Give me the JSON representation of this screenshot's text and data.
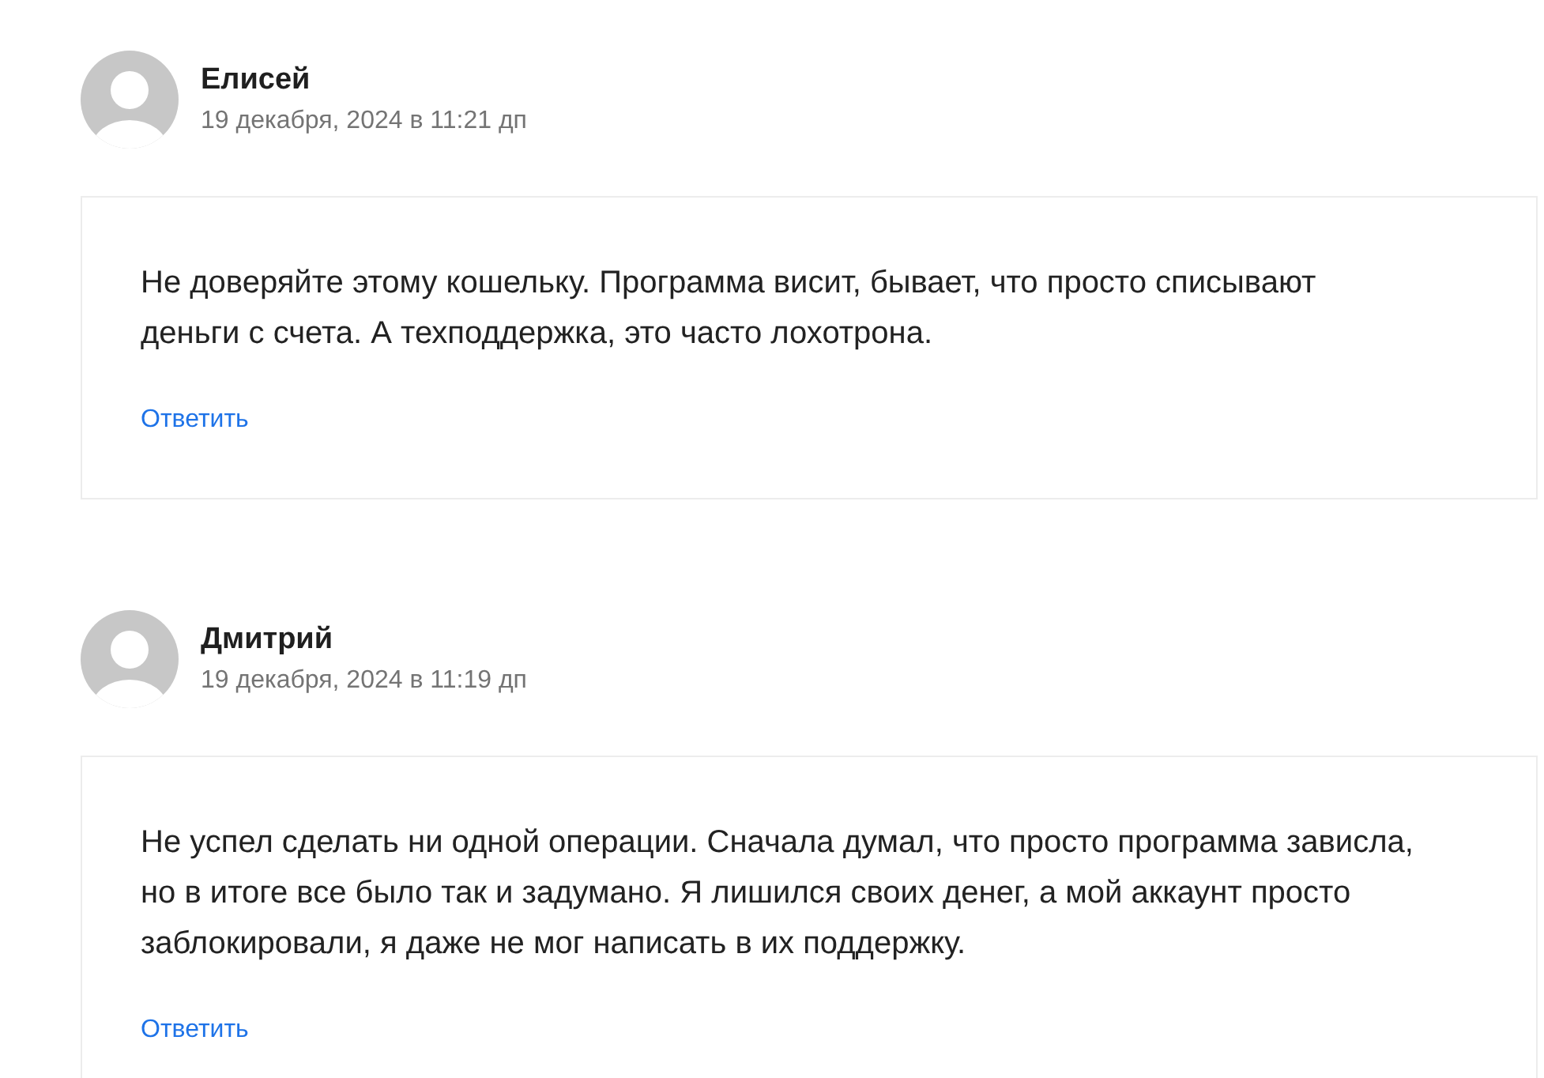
{
  "comments": [
    {
      "author": "Елисей",
      "date": "19 декабря, 2024 в 11:21 дп",
      "text": "Не доверяйте этому кошельку. Программа висит, бывает, что просто списывают деньги с счета. А техподдержка, это часто лохотрона.",
      "reply": "Ответить"
    },
    {
      "author": "Дмитрий",
      "date": "19 декабря, 2024 в 11:19 дп",
      "text": "Не успел сделать ни одной операции. Сначала думал, что просто программа зависла, но в итоге все было так и задумано. Я лишился своих денег, а мой аккаунт просто заблокировали, я даже не мог написать в их поддержку.",
      "reply": "Ответить"
    }
  ]
}
